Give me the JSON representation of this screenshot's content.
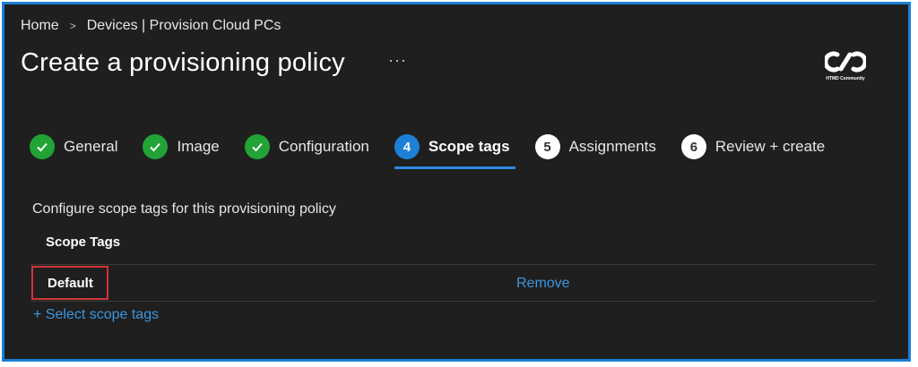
{
  "breadcrumb": {
    "home": "Home",
    "separator": ">",
    "current": "Devices | Provision Cloud PCs"
  },
  "page": {
    "title": "Create a provisioning policy",
    "more": "···"
  },
  "logo": {
    "caption": "HTMD Community"
  },
  "steps": [
    {
      "number": "",
      "label": "General",
      "status": "complete"
    },
    {
      "number": "",
      "label": "Image",
      "status": "complete"
    },
    {
      "number": "",
      "label": "Configuration",
      "status": "complete"
    },
    {
      "number": "4",
      "label": "Scope tags",
      "status": "current"
    },
    {
      "number": "5",
      "label": "Assignments",
      "status": "pending"
    },
    {
      "number": "6",
      "label": "Review + create",
      "status": "pending"
    }
  ],
  "content": {
    "description": "Configure scope tags for this provisioning policy",
    "column_header": "Scope Tags",
    "rows": [
      {
        "tag": "Default",
        "action": "Remove"
      }
    ],
    "add_link": "+ Select scope tags"
  },
  "colors": {
    "accent": "#1e7fd6",
    "complete": "#21a336",
    "link": "#3a96dd",
    "highlight_border": "#d13438",
    "background": "#1f1f1f"
  }
}
